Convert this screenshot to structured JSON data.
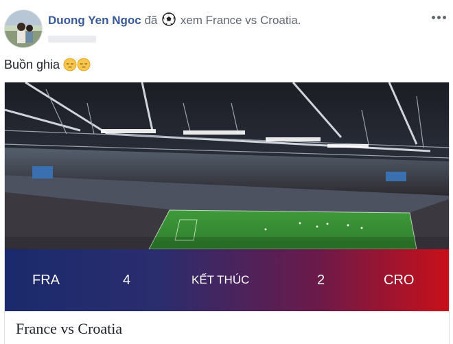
{
  "post": {
    "author_name": "Duong Yen Ngoc",
    "verb": "đã",
    "activity_icon": "soccer-ball-icon",
    "activity_text": "xem France vs Croatia.",
    "message": "Buồn ghia",
    "message_emojis": [
      "pensive-face-icon",
      "pensive-face-icon"
    ]
  },
  "card": {
    "image": "stadium-photo",
    "score": {
      "home_team": "FRA",
      "home_score": "4",
      "status": "KẾT THÚC",
      "away_score": "2",
      "away_team": "CRO"
    },
    "title": "France vs Croatia"
  },
  "colors": {
    "author_link": "#385898",
    "scorebar_left": "#1a2a6c",
    "scorebar_right": "#c8101a"
  }
}
